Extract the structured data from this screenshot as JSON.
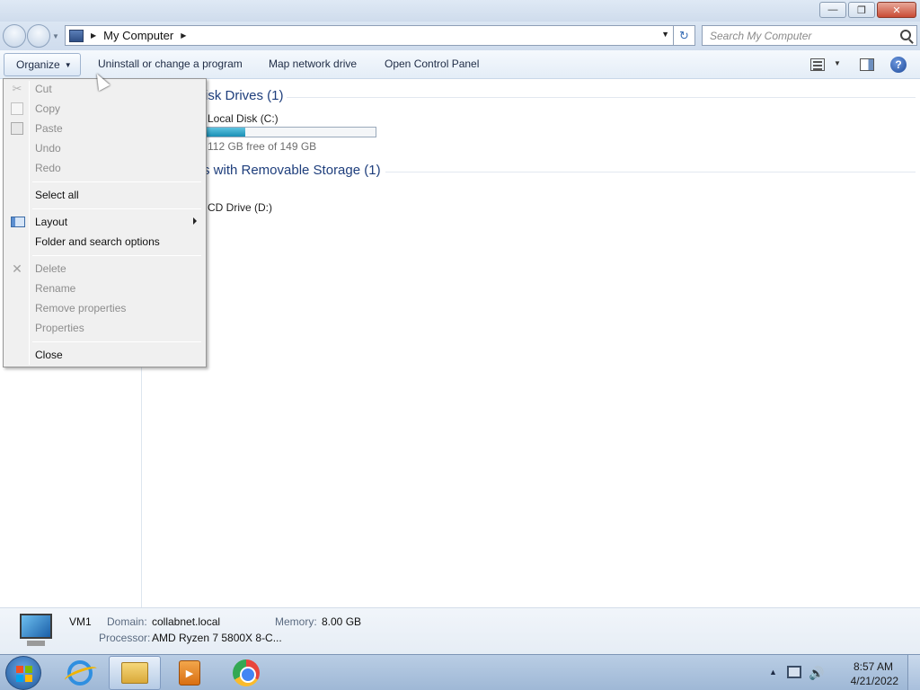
{
  "window": {
    "minimize_glyph": "—",
    "maximize_glyph": "❐",
    "close_glyph": "✕"
  },
  "address": {
    "location": "My Computer",
    "crumb_sep": "▶",
    "dropdown_glyph": "▼",
    "refresh_glyph": "↻"
  },
  "search": {
    "placeholder": "Search My Computer"
  },
  "commands": {
    "organize": "Organize",
    "organize_arrow": "▼",
    "uninstall": "Uninstall or change a program",
    "map_drive": "Map network drive",
    "control_panel": "Open Control Panel",
    "views_arrow": "▼",
    "help_glyph": "?"
  },
  "groups": {
    "hdd_header": "isk Drives (1)",
    "removable_header": "s with Removable Storage (1)"
  },
  "drives": {
    "c_name": "Local Disk (C:)",
    "c_free": "112 GB free of 149 GB",
    "c_used_fraction": 0.248,
    "d_name": "CD Drive (D:)"
  },
  "details": {
    "name": "VM1",
    "domain_label": "Domain:",
    "domain_value": "collabnet.local",
    "memory_label": "Memory:",
    "memory_value": "8.00 GB",
    "processor_label": "Processor:",
    "processor_value": "AMD Ryzen 7 5800X 8-C..."
  },
  "menu": {
    "cut": "Cut",
    "copy": "Copy",
    "paste": "Paste",
    "undo": "Undo",
    "redo": "Redo",
    "select_all": "Select all",
    "layout": "Layout",
    "folder_options": "Folder and search options",
    "delete": "Delete",
    "rename": "Rename",
    "remove_properties": "Remove properties",
    "properties": "Properties",
    "close": "Close",
    "cut_glyph": "✂",
    "delete_glyph": "✕"
  },
  "taskbar": {
    "time": "8:57 AM",
    "date": "4/21/2022",
    "tray_arrow": "▲",
    "volume_glyph": "🔊",
    "media_glyph": "▶"
  },
  "colors": {
    "link_blue": "#1e3e7c",
    "drive_fill": "#1a8fb5",
    "menu_bg": "#f0f0f0",
    "disabled_text": "#8d8d8d"
  }
}
